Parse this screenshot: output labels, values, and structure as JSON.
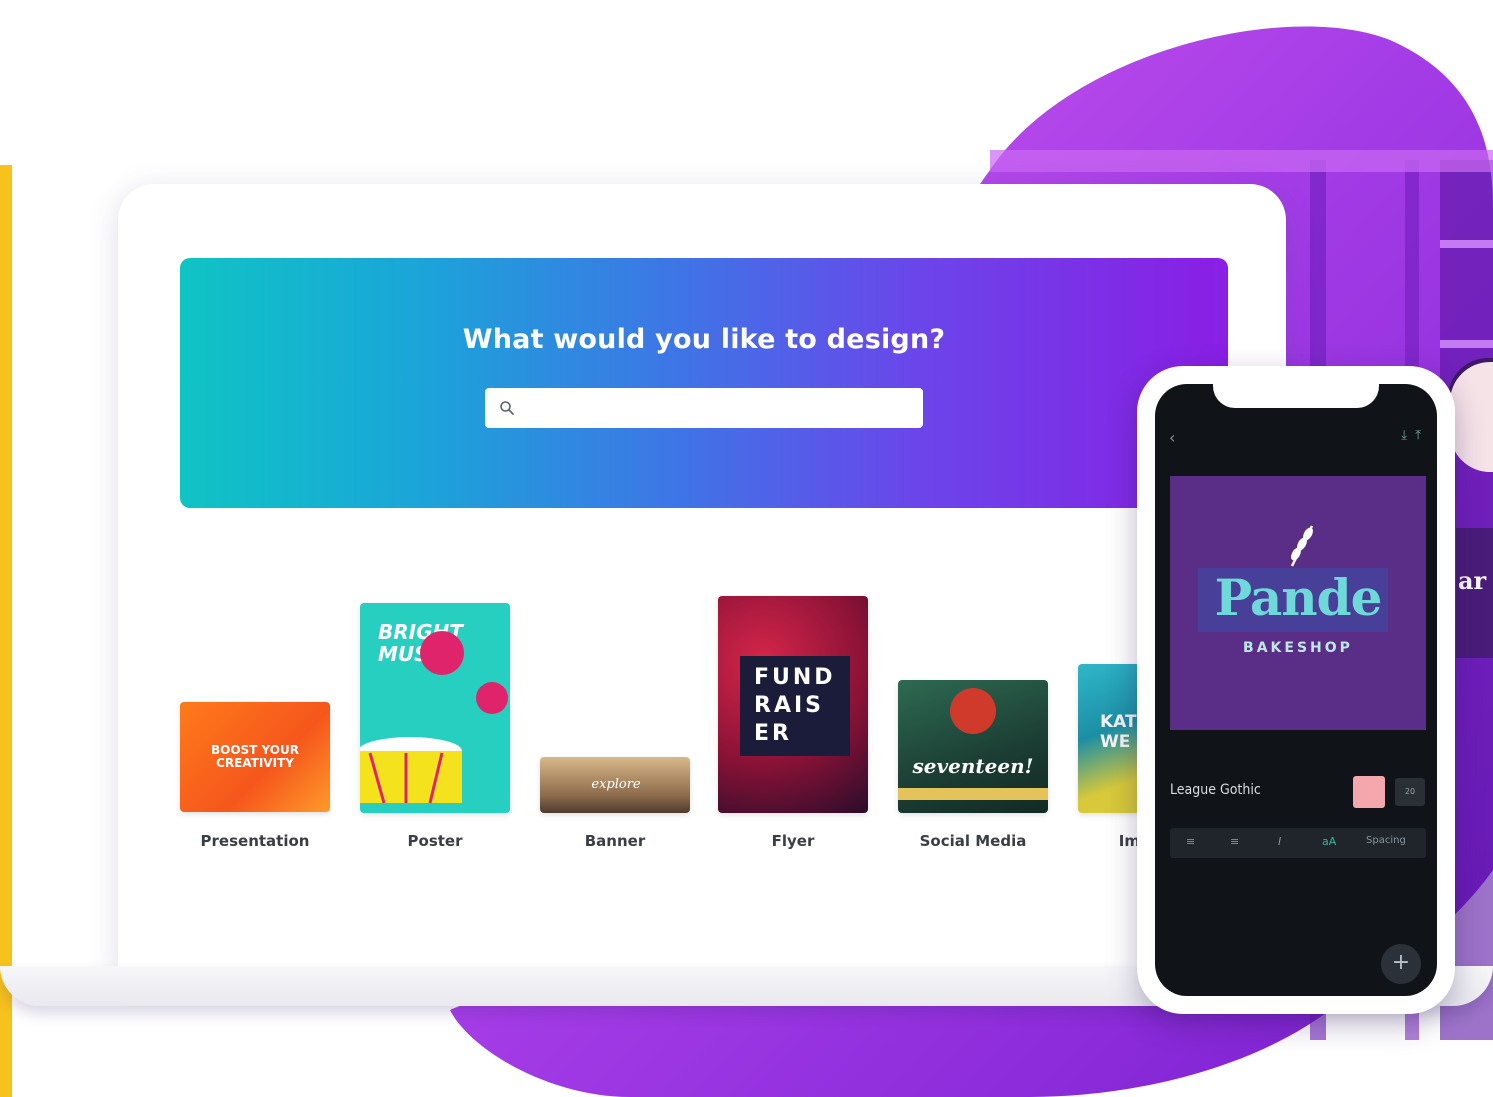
{
  "hero": {
    "title": "What would you like to design?",
    "search_placeholder": ""
  },
  "templates": [
    {
      "label": "Presentation",
      "preview_text": "BOOST YOUR CREATIVITY"
    },
    {
      "label": "Poster",
      "preview_text": "BRIGHT MUSIC"
    },
    {
      "label": "Banner",
      "preview_text": "explore"
    },
    {
      "label": "Flyer",
      "preview_text": "FUND RAIS ER"
    },
    {
      "label": "Social Media",
      "preview_text": "seventeen!"
    },
    {
      "label": "Im",
      "preview_text": "KAT WE"
    }
  ],
  "phone": {
    "logo_title": "Pande",
    "logo_subtitle": "BAKESHOP",
    "font_name": "League Gothic",
    "font_size_label": "20",
    "tools": [
      "≡",
      "≡",
      "I",
      "aA",
      "Spacing"
    ],
    "fab_label": "+"
  },
  "side_sign_text": "ar",
  "colors": {
    "accent_yellow": "#f8c21c",
    "hero_start": "#0fc4c4",
    "hero_end": "#8a1ee4",
    "brand_purple": "#8a1ee4"
  }
}
